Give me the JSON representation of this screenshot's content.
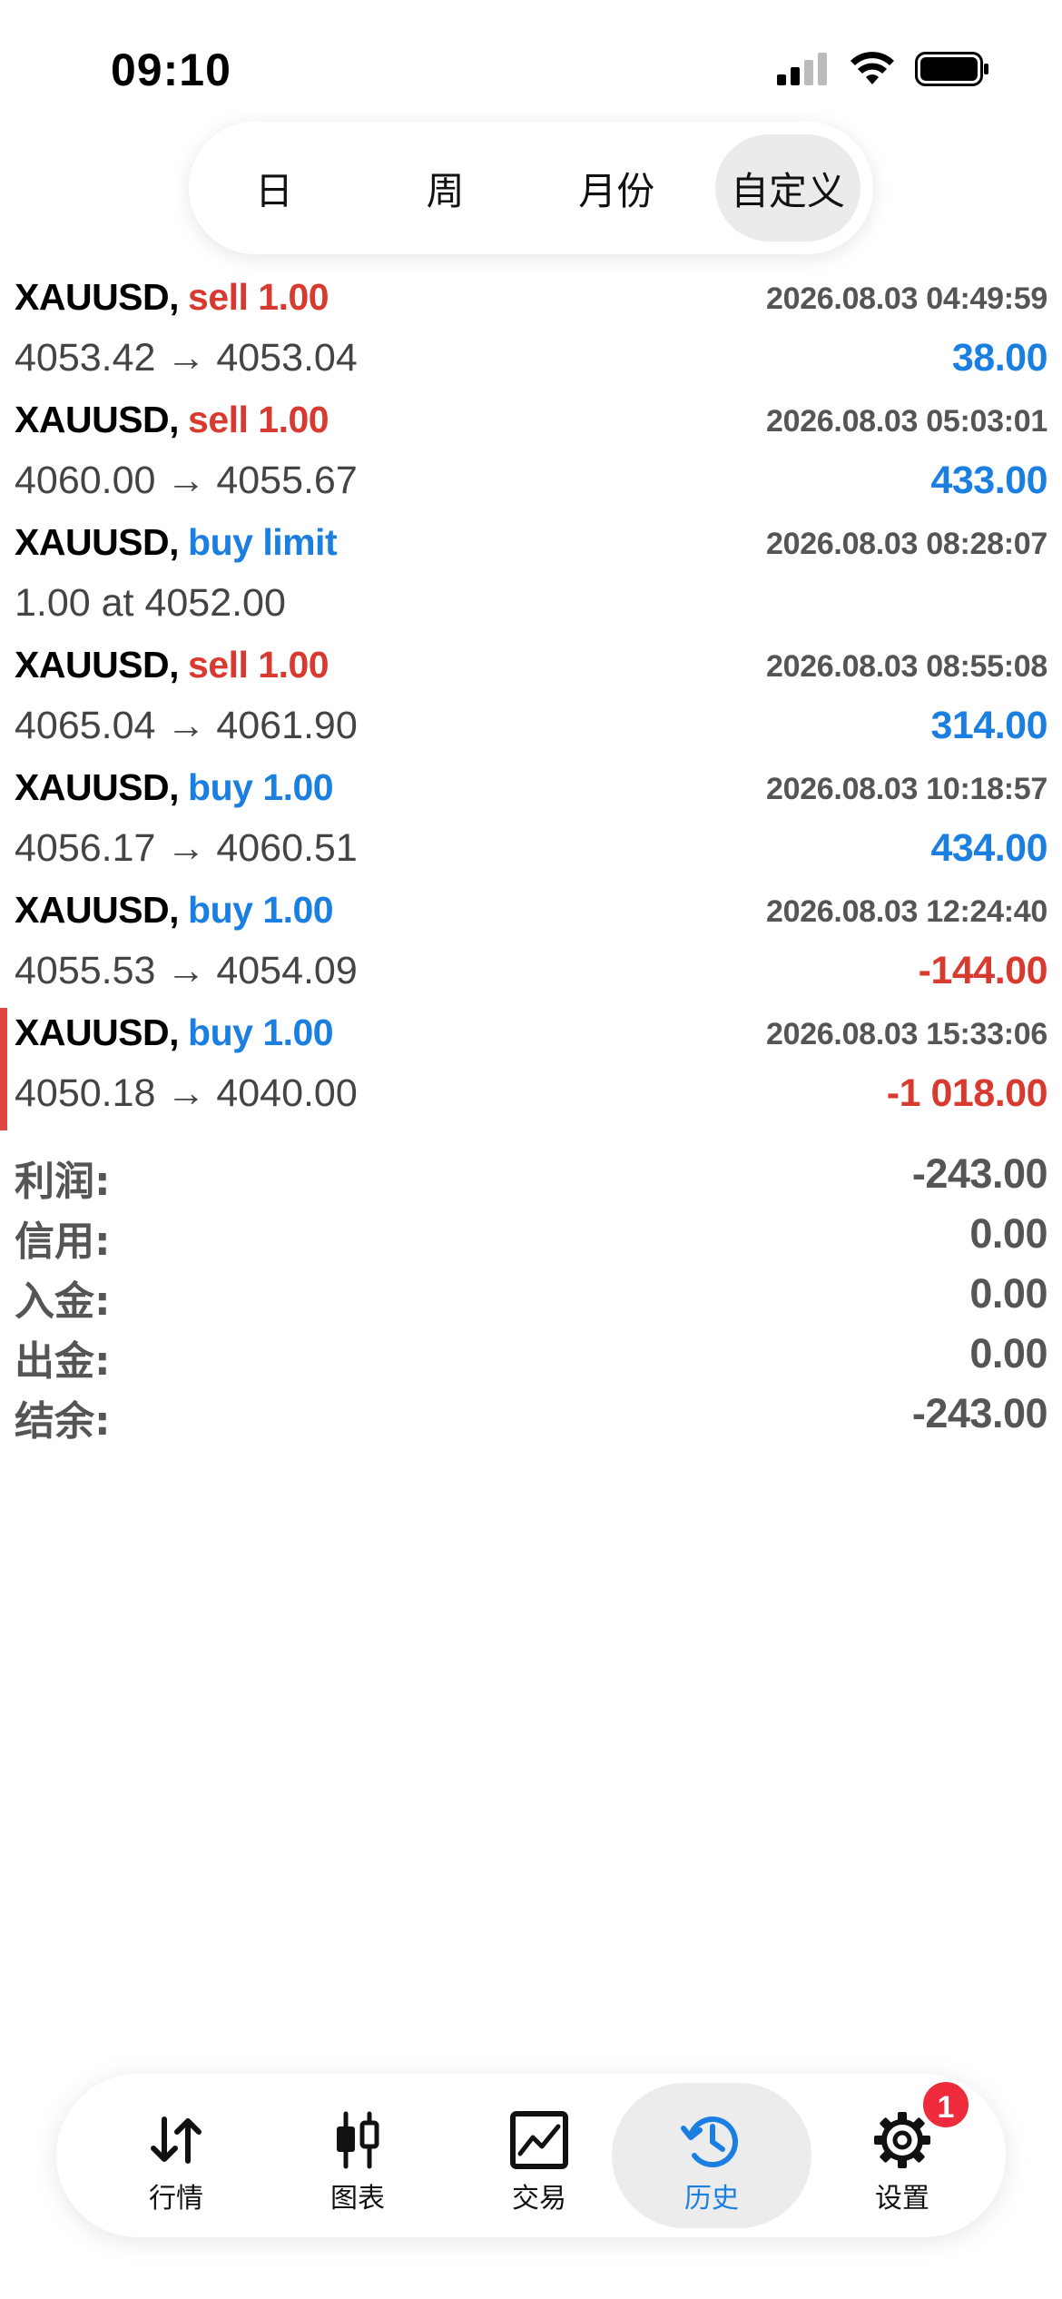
{
  "status_bar": {
    "time": "09:10"
  },
  "period_tabs": [
    {
      "label": "日",
      "active": false
    },
    {
      "label": "周",
      "active": false
    },
    {
      "label": "月份",
      "active": false
    },
    {
      "label": "自定义",
      "active": true
    }
  ],
  "trades": [
    {
      "symbol": "XAUUSD,",
      "type": "sell 1.00",
      "type_color": "red",
      "time": "2026.08.03 04:49:59",
      "detail": "4053.42 → 4053.04",
      "profit": "38.00",
      "profit_color": "blue"
    },
    {
      "symbol": "XAUUSD,",
      "type": "sell 1.00",
      "type_color": "red",
      "time": "2026.08.03 05:03:01",
      "detail": "4060.00 → 4055.67",
      "profit": "433.00",
      "profit_color": "blue"
    },
    {
      "symbol": "XAUUSD,",
      "type": "buy limit",
      "type_color": "blue",
      "time": "2026.08.03 08:28:07",
      "detail": "1.00 at 4052.00",
      "profit": "",
      "profit_color": "blue"
    },
    {
      "symbol": "XAUUSD,",
      "type": "sell 1.00",
      "type_color": "red",
      "time": "2026.08.03 08:55:08",
      "detail": "4065.04 → 4061.90",
      "profit": "314.00",
      "profit_color": "blue"
    },
    {
      "symbol": "XAUUSD,",
      "type": "buy 1.00",
      "type_color": "blue",
      "time": "2026.08.03 10:18:57",
      "detail": "4056.17 → 4060.51",
      "profit": "434.00",
      "profit_color": "blue"
    },
    {
      "symbol": "XAUUSD,",
      "type": "buy 1.00",
      "type_color": "blue",
      "time": "2026.08.03 12:24:40",
      "detail": "4055.53 → 4054.09",
      "profit": "-144.00",
      "profit_color": "red"
    },
    {
      "symbol": "XAUUSD,",
      "type": "buy 1.00",
      "type_color": "blue",
      "time": "2026.08.03 15:33:06",
      "detail": "4050.18 → 4040.00",
      "profit": "-1 018.00",
      "profit_color": "red",
      "highlighted": true
    }
  ],
  "summary": [
    {
      "label": "利润:",
      "value": "-243.00"
    },
    {
      "label": "信用:",
      "value": "0.00"
    },
    {
      "label": "入金:",
      "value": "0.00"
    },
    {
      "label": "出金:",
      "value": "0.00"
    },
    {
      "label": "结余:",
      "value": "-243.00"
    }
  ],
  "tabbar": [
    {
      "label": "行情",
      "icon": "quotes-arrows-icon",
      "active": false
    },
    {
      "label": "图表",
      "icon": "candlestick-chart-icon",
      "active": false
    },
    {
      "label": "交易",
      "icon": "trade-chart-icon",
      "active": false
    },
    {
      "label": "历史",
      "icon": "history-clock-icon",
      "active": true
    },
    {
      "label": "设置",
      "icon": "gear-icon",
      "active": false,
      "badge": "1"
    }
  ],
  "colors": {
    "sell": "#d93a2f",
    "buy": "#1a7fe0",
    "profit_positive": "#1a7fe0",
    "profit_negative": "#d93a2f",
    "badge": "#ee2b3b",
    "active_tab": "#1a7fe0"
  }
}
